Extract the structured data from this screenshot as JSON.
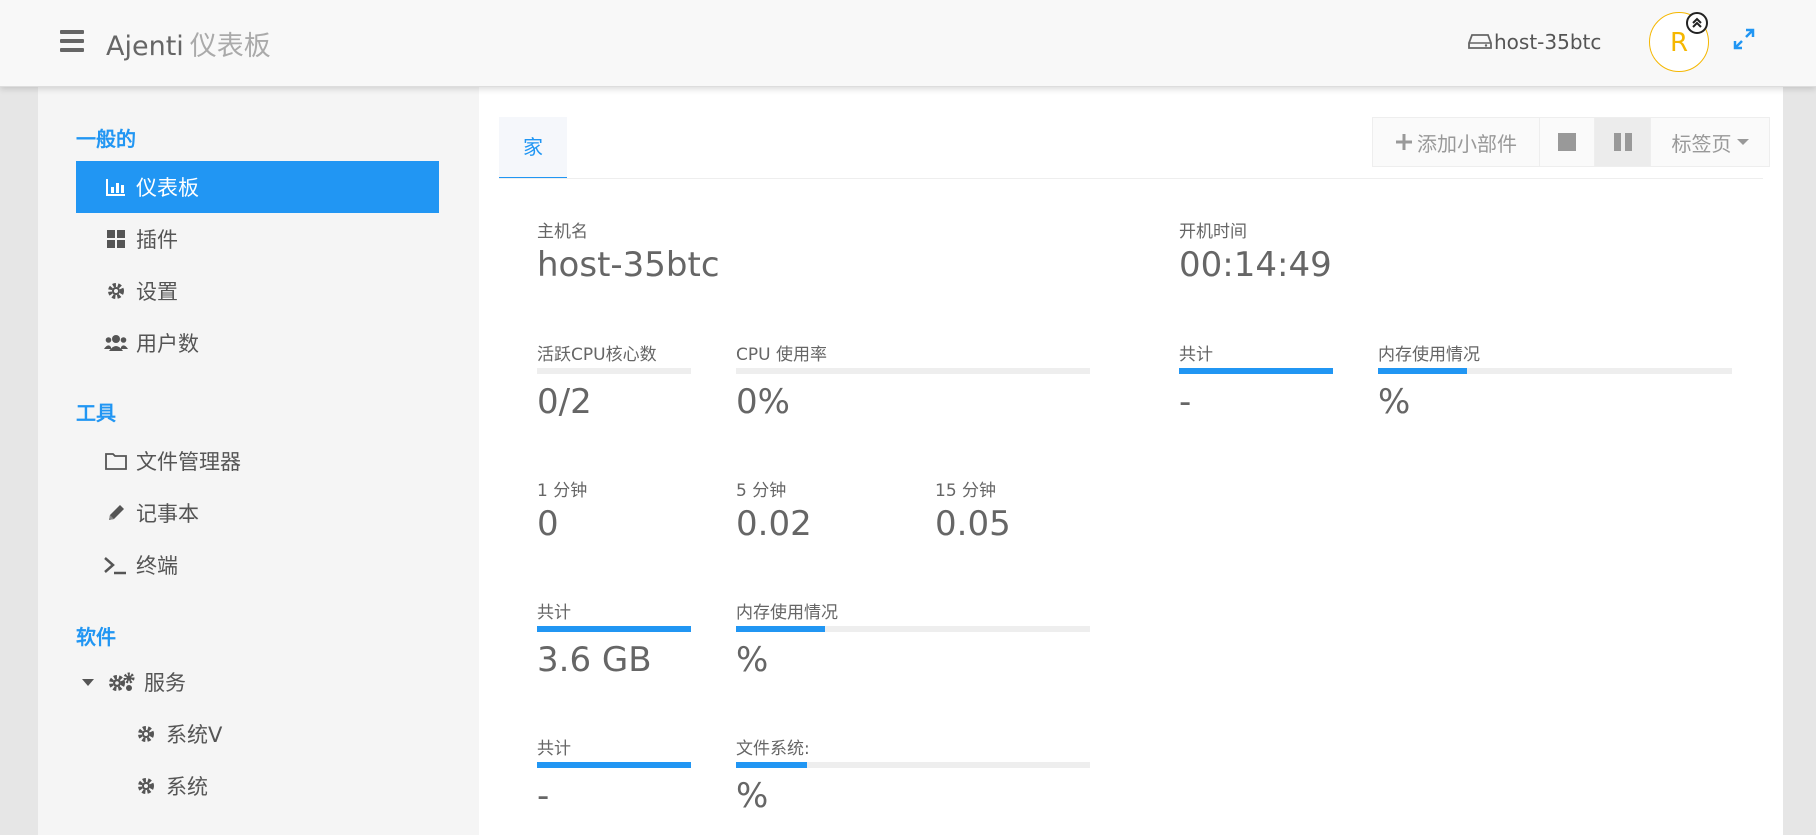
{
  "header": {
    "brand": "Ajenti",
    "brand_sub": "仪表板",
    "host": "host-35btc",
    "avatar_letter": "R",
    "icons": [
      "menu-icon",
      "server-icon",
      "chevron-double-up-icon",
      "expand-icon"
    ]
  },
  "sidebar": {
    "sections": [
      {
        "title": "一般的",
        "items": [
          {
            "label": "仪表板",
            "icon": "chart-bar-icon",
            "active": true
          },
          {
            "label": "插件",
            "icon": "grid-icon"
          },
          {
            "label": "设置",
            "icon": "gear-icon"
          },
          {
            "label": "用户数",
            "icon": "users-icon"
          }
        ]
      },
      {
        "title": "工具",
        "items": [
          {
            "label": "文件管理器",
            "icon": "folder-icon"
          },
          {
            "label": "记事本",
            "icon": "pencil-icon"
          },
          {
            "label": "终端",
            "icon": "terminal-icon"
          }
        ]
      },
      {
        "title": "软件",
        "items": [
          {
            "label": "服务",
            "icon": "gears-icon",
            "expanded": true
          },
          {
            "label": "系统V",
            "icon": "gear-icon"
          },
          {
            "label": "系统",
            "icon": "gear-icon"
          }
        ]
      }
    ]
  },
  "main": {
    "tab": "家",
    "toolbar": {
      "add_widget": "添加小部件",
      "tabs_label": "标签页"
    },
    "hostname": {
      "label": "主机名",
      "value": "host-35btc"
    },
    "uptime": {
      "label": "开机时间",
      "value": "00:14:49"
    },
    "cpu_cores": {
      "label": "活跃CPU核心数",
      "value": "0/2",
      "fill": 0
    },
    "cpu_usage": {
      "label": "CPU 使用率",
      "value": "0%",
      "fill": 0
    },
    "load": [
      {
        "label": "1 分钟",
        "value": "0"
      },
      {
        "label": "5 分钟",
        "value": "0.02"
      },
      {
        "label": "15 分钟",
        "value": "0.05"
      }
    ],
    "memory_total": {
      "label": "共计",
      "value": "3.6 GB",
      "fill": 1
    },
    "memory_usage": {
      "label": "内存使用情况",
      "value": "%",
      "fill": 0.25
    },
    "fs_total": {
      "label": "共计",
      "value": "-",
      "fill": 1
    },
    "fs_usage": {
      "label": "文件系统:",
      "value": "%",
      "fill": 0.2
    },
    "swap_total": {
      "label": "共计",
      "value": "-",
      "fill": 1
    },
    "swap_usage": {
      "label": "内存使用情况",
      "value": "%",
      "fill": 0.25
    }
  },
  "colors": {
    "accent": "#2196f3",
    "avatar": "#f5b700",
    "bar_bg": "#eeeeee"
  }
}
